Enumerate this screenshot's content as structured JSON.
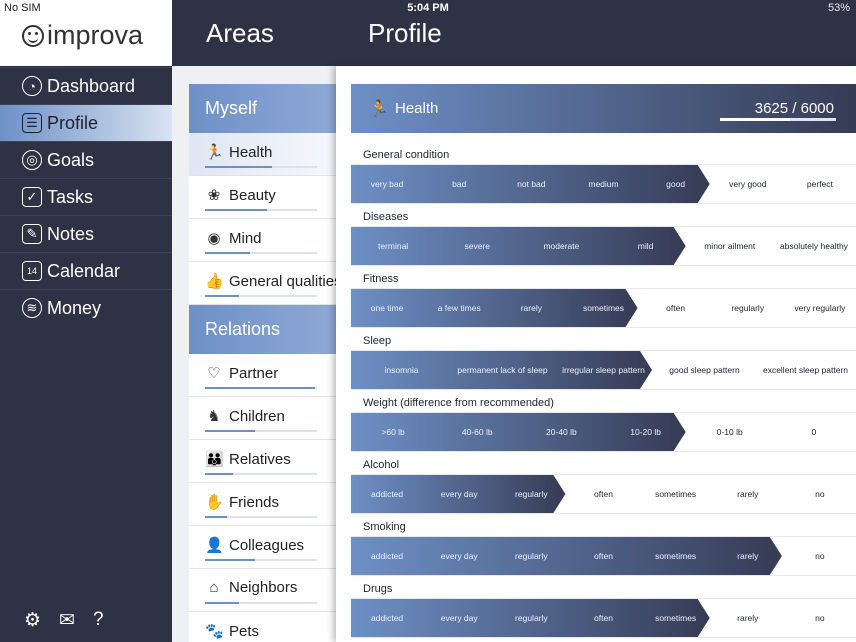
{
  "status": {
    "carrier": "No SIM",
    "time": "5:04 PM",
    "battery": "53%"
  },
  "app": {
    "name": "improva"
  },
  "nav": [
    {
      "label": "Dashboard",
      "icon": "dashboard-icon",
      "glyph": "◔"
    },
    {
      "label": "Profile",
      "icon": "profile-icon",
      "glyph": "☰",
      "active": true
    },
    {
      "label": "Goals",
      "icon": "goals-icon",
      "glyph": "◎"
    },
    {
      "label": "Tasks",
      "icon": "tasks-icon",
      "glyph": "✓"
    },
    {
      "label": "Notes",
      "icon": "notes-icon",
      "glyph": "✎"
    },
    {
      "label": "Calendar",
      "icon": "calendar-icon",
      "glyph": "14"
    },
    {
      "label": "Money",
      "icon": "money-icon",
      "glyph": "≋"
    }
  ],
  "footer_icons": [
    "settings-icon",
    "mail-icon",
    "help-icon"
  ],
  "areas": {
    "title": "Areas",
    "sections": [
      {
        "title": "Myself",
        "items": [
          {
            "label": "Health",
            "icon": "running-icon",
            "glyph": "🏃",
            "active": true,
            "progress": 0.6
          },
          {
            "label": "Beauty",
            "icon": "butterfly-icon",
            "glyph": "❀",
            "progress": 0.55
          },
          {
            "label": "Mind",
            "icon": "brain-icon",
            "glyph": "◉",
            "progress": 0.4
          },
          {
            "label": "General qualities",
            "icon": "thumbs-up-icon",
            "glyph": "👍",
            "progress": 0.3
          }
        ]
      },
      {
        "title": "Relations",
        "items": [
          {
            "label": "Partner",
            "icon": "heart-icon",
            "glyph": "♡",
            "progress": 0.98
          },
          {
            "label": "Children",
            "icon": "rocking-horse-icon",
            "glyph": "♞",
            "progress": 0.45
          },
          {
            "label": "Relatives",
            "icon": "people-icon",
            "glyph": "👪",
            "progress": 0.25
          },
          {
            "label": "Friends",
            "icon": "hand-icon",
            "glyph": "✋",
            "progress": 0.2
          },
          {
            "label": "Colleagues",
            "icon": "worker-icon",
            "glyph": "👤",
            "progress": 0.45
          },
          {
            "label": "Neighbors",
            "icon": "house-icon",
            "glyph": "⌂",
            "progress": 0.3
          },
          {
            "label": "Pets",
            "icon": "paw-icon",
            "glyph": "🐾",
            "progress": 0.2
          }
        ]
      }
    ]
  },
  "profile": {
    "title": "Profile",
    "header": {
      "label": "Health",
      "icon": "running-icon",
      "score": "3625 / 6000",
      "score_fraction": 0.604
    },
    "metrics": [
      {
        "label": "General condition",
        "options": [
          "very bad",
          "bad",
          "not bad",
          "medium",
          "good",
          "very good",
          "perfect"
        ],
        "selected": 4
      },
      {
        "label": "Diseases",
        "options": [
          "terminal",
          "severe",
          "moderate",
          "mild",
          "minor ailment",
          "absolutely healthy"
        ],
        "selected": 3
      },
      {
        "label": "Fitness",
        "options": [
          "one time",
          "a few times",
          "rarely",
          "sometimes",
          "often",
          "regularly",
          "very regularly"
        ],
        "selected": 3
      },
      {
        "label": "Sleep",
        "options": [
          "insomnia",
          "permanent lack of sleep",
          "irregular sleep pattern",
          "good sleep pattern",
          "excellent sleep pattern"
        ],
        "selected": 2
      },
      {
        "label": "Weight (difference from recommended)",
        "options": [
          ">60 lb",
          "40-60 lb",
          "20-40 lb",
          "10-20 lb",
          "0-10 lb",
          "0"
        ],
        "selected": 3
      },
      {
        "label": "Alcohol",
        "options": [
          "addicted",
          "every day",
          "regularly",
          "often",
          "sometimes",
          "rarely",
          "no"
        ],
        "selected": 2
      },
      {
        "label": "Smoking",
        "options": [
          "addicted",
          "every day",
          "regularly",
          "often",
          "sometimes",
          "rarely",
          "no"
        ],
        "selected": 5
      },
      {
        "label": "Drugs",
        "options": [
          "addicted",
          "every day",
          "regularly",
          "often",
          "sometimes",
          "rarely",
          "no"
        ],
        "selected": 4
      }
    ]
  },
  "colors": {
    "sidebar": "#2f3244",
    "accent": "#6e90c6",
    "dark_accent": "#363b55"
  }
}
